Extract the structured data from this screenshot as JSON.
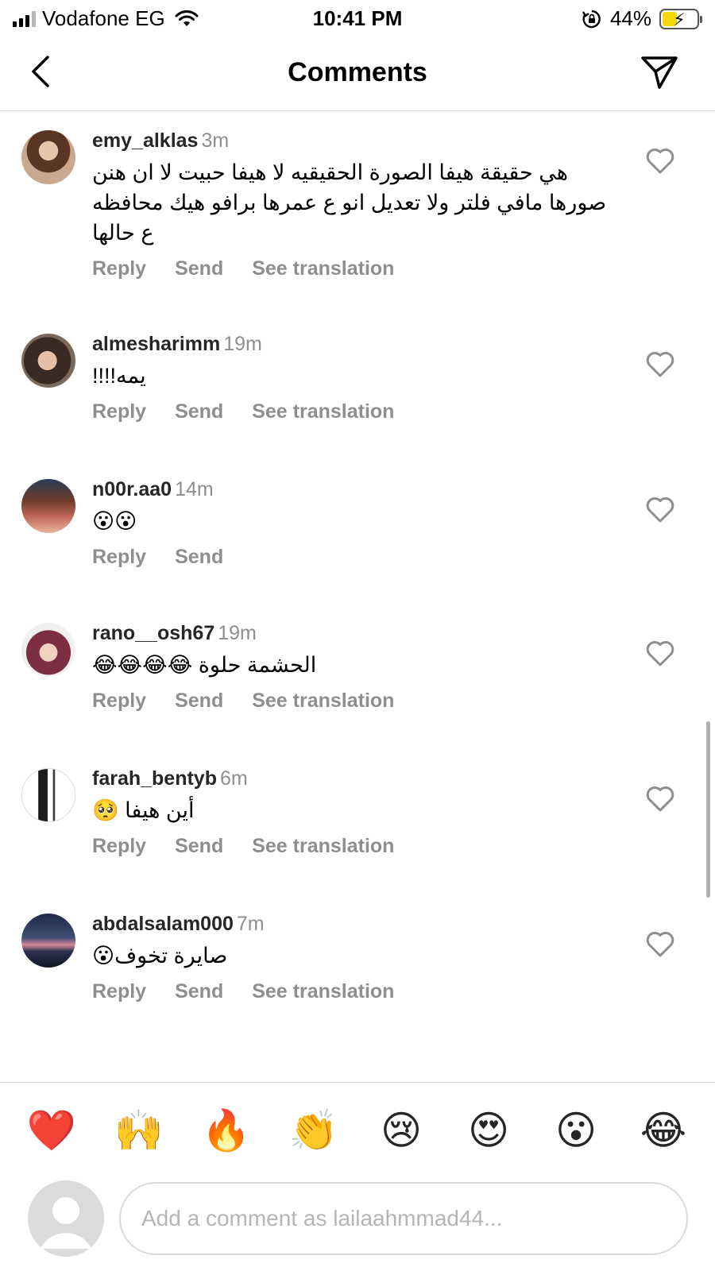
{
  "status_bar": {
    "carrier": "Vodafone EG",
    "time": "10:41 PM",
    "battery_percent": "44%",
    "battery_level": 0.44,
    "icons": [
      "signal-icon",
      "wifi-icon",
      "orientation-lock-icon",
      "battery-icon"
    ]
  },
  "header": {
    "title": "Comments",
    "back_icon": "chevron-left-icon",
    "share_icon": "paper-plane-icon"
  },
  "comments": [
    {
      "username": "emy_alklas",
      "time": "3m",
      "text": "هي حقيقة هيفا الصورة الحقيقيه لا هيفا حبيت لا ان هنن صورها مافي فلتر ولا تعديل انو ع عمرها برافو هيك محافظه ع حالها",
      "actions": [
        "Reply",
        "Send",
        "See translation"
      ]
    },
    {
      "username": "almesharimm",
      "time": "19m",
      "text": "يمه!!!!",
      "actions": [
        "Reply",
        "Send",
        "See translation"
      ]
    },
    {
      "username": "n00r.aa0",
      "time": "14m",
      "text": "😮😮",
      "actions": [
        "Reply",
        "Send"
      ]
    },
    {
      "username": "rano__osh67",
      "time": "19m",
      "text": "الحشمة حلوة 😂😂😂😂",
      "actions": [
        "Reply",
        "Send",
        "See translation"
      ]
    },
    {
      "username": "farah_bentyb",
      "time": "6m",
      "text": "أين هيفا 🥺",
      "actions": [
        "Reply",
        "Send",
        "See translation"
      ]
    },
    {
      "username": "abdalsalam000",
      "time": "7m",
      "text": "صايرة تخوف😮",
      "actions": [
        "Reply",
        "Send",
        "See translation"
      ]
    }
  ],
  "reactions": [
    "❤️",
    "🙌",
    "🔥",
    "👏",
    "😢",
    "😍",
    "😮",
    "😂"
  ],
  "composer": {
    "placeholder": "Add a comment as lailaahmmad44..."
  },
  "colors": {
    "text_primary": "#262626",
    "text_secondary": "#8e8e8e",
    "divider": "#dbdbdb",
    "battery_fill": "#f5d90a"
  }
}
